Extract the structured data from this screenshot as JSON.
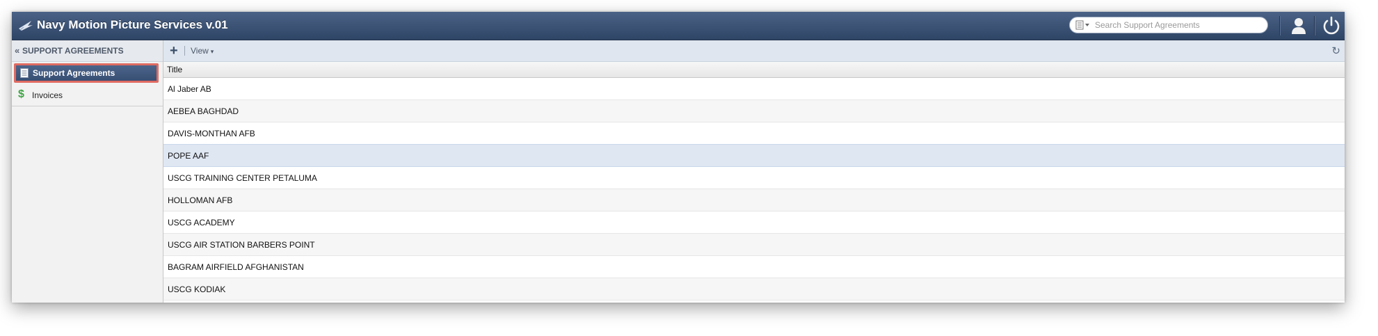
{
  "app": {
    "title": "Navy Motion Picture Services v.01"
  },
  "search": {
    "placeholder": "Search Support Agreements"
  },
  "sidebar": {
    "title": "SUPPORT AGREEMENTS",
    "collapse_glyph": "«",
    "items": [
      {
        "label": "Support Agreements",
        "icon": "document-icon",
        "active": true
      },
      {
        "label": "Invoices",
        "icon": "dollar-icon",
        "active": false
      }
    ]
  },
  "toolbar": {
    "add_glyph": "+",
    "view_label": "View",
    "view_caret": "▾",
    "refresh_glyph": "↻"
  },
  "grid": {
    "columns": [
      "Title"
    ],
    "rows": [
      "Al Jaber AB",
      "AEBEA BAGHDAD",
      "DAVIS-MONTHAN AFB",
      "POPE AAF",
      "USCG TRAINING CENTER PETALUMA",
      "HOLLOMAN AFB",
      "USCG ACADEMY",
      "USCG AIR STATION BARBERS POINT",
      "BAGRAM AIRFIELD AFGHANISTAN",
      "USCG KODIAK"
    ],
    "selected_row_index": 3
  },
  "colors": {
    "topbar": "#3b5275",
    "highlight_outline": "#e06b62",
    "selected_row": "#dfe7f3",
    "invoice_icon": "#3fa545"
  }
}
